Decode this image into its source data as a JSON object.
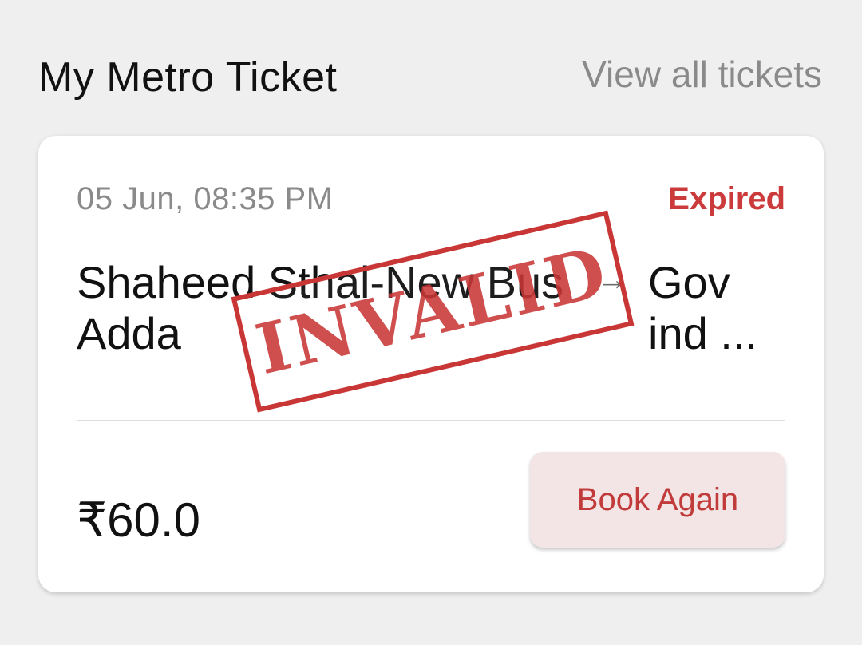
{
  "header": {
    "title": "My Metro Ticket",
    "view_all_label": "View all tickets"
  },
  "ticket": {
    "datetime": "05 Jun, 08:35 PM",
    "status": "Expired",
    "origin": "Shaheed Sthal-New Bus Adda",
    "route_arrow": "→",
    "destination": "Gov ind ...",
    "stamp_text": "INVALID",
    "fare": "₹60.0",
    "book_again_label": "Book Again"
  },
  "colors": {
    "accent_red": "#cc3b3b",
    "button_bg": "#f3e5e6",
    "page_bg": "#efefef",
    "muted_text": "#8a8a8a"
  }
}
